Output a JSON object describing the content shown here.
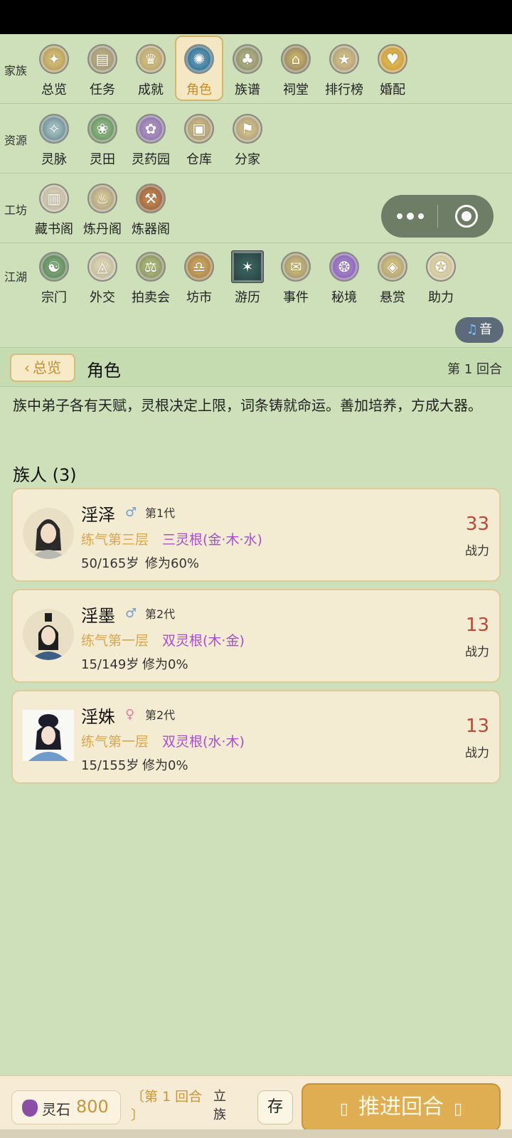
{
  "nav": {
    "sections": [
      {
        "label": "家族",
        "items": [
          {
            "label": "总览",
            "icon": "overview-icon"
          },
          {
            "label": "任务",
            "icon": "task-icon"
          },
          {
            "label": "成就",
            "icon": "achievement-icon"
          },
          {
            "label": "角色",
            "icon": "character-icon",
            "active": true
          },
          {
            "label": "族谱",
            "icon": "family-tree-icon"
          },
          {
            "label": "祠堂",
            "icon": "ancestral-hall-icon"
          },
          {
            "label": "排行榜",
            "icon": "ranking-icon"
          },
          {
            "label": "婚配",
            "icon": "marriage-icon"
          }
        ]
      },
      {
        "label": "资源",
        "items": [
          {
            "label": "灵脉",
            "icon": "spirit-vein-icon"
          },
          {
            "label": "灵田",
            "icon": "spirit-field-icon"
          },
          {
            "label": "灵药园",
            "icon": "herb-garden-icon"
          },
          {
            "label": "仓库",
            "icon": "warehouse-icon"
          },
          {
            "label": "分家",
            "icon": "branch-family-icon"
          }
        ]
      },
      {
        "label": "工坊",
        "items": [
          {
            "label": "藏书阁",
            "icon": "library-icon"
          },
          {
            "label": "炼丹阁",
            "icon": "alchemy-icon"
          },
          {
            "label": "炼器阁",
            "icon": "forge-icon"
          }
        ]
      },
      {
        "label": "江湖",
        "items": [
          {
            "label": "宗门",
            "icon": "sect-icon"
          },
          {
            "label": "外交",
            "icon": "diplomacy-icon"
          },
          {
            "label": "拍卖会",
            "icon": "auction-icon"
          },
          {
            "label": "坊市",
            "icon": "market-icon"
          },
          {
            "label": "游历",
            "icon": "travel-icon"
          },
          {
            "label": "事件",
            "icon": "event-icon"
          },
          {
            "label": "秘境",
            "icon": "secret-realm-icon"
          },
          {
            "label": "悬赏",
            "icon": "bounty-icon"
          },
          {
            "label": "助力",
            "icon": "assist-icon"
          }
        ]
      }
    ]
  },
  "music_button": {
    "label": "音",
    "icon": "music-note-icon"
  },
  "header": {
    "back_label": "总览",
    "title": "角色",
    "round": "第 1 回合"
  },
  "description": "族中弟子各有天赋，灵根决定上限，词条铸就命运。善加培养，方成大器。",
  "members_heading": "族人 (3)",
  "members": [
    {
      "name": "淫泽",
      "gender": "male",
      "gender_symbol": "♂",
      "generation": "第1代",
      "realm": "练气第三层",
      "root": "三灵根(金·木·水)",
      "age": "50/165岁",
      "cultivation": "修为60%",
      "power": "33",
      "power_label": "战力"
    },
    {
      "name": "淫墨",
      "gender": "male",
      "gender_symbol": "♂",
      "generation": "第2代",
      "realm": "练气第一层",
      "root": "双灵根(木·金)",
      "age": "15/149岁",
      "cultivation": "修为0%",
      "power": "13",
      "power_label": "战力"
    },
    {
      "name": "淫姝",
      "gender": "female",
      "gender_symbol": "♀",
      "generation": "第2代",
      "realm": "练气第一层",
      "root": "双灵根(水·木)",
      "age": "15/155岁",
      "cultivation": "修为0%",
      "power": "13",
      "power_label": "战力"
    }
  ],
  "bottom": {
    "stone_label": "灵石",
    "stone_value": "800",
    "round_tag_line1": "〔第 1 回合",
    "round_tag_line2": "〕",
    "lizu_line1": "立",
    "lizu_line2": "族",
    "save_label": "存",
    "advance_label": "推进回合"
  },
  "colors": {
    "background": "#cde0b9",
    "realm": "#dca64b",
    "root": "#a64fd0",
    "power": "#b84a3a",
    "advance_button": "#dfae53"
  }
}
